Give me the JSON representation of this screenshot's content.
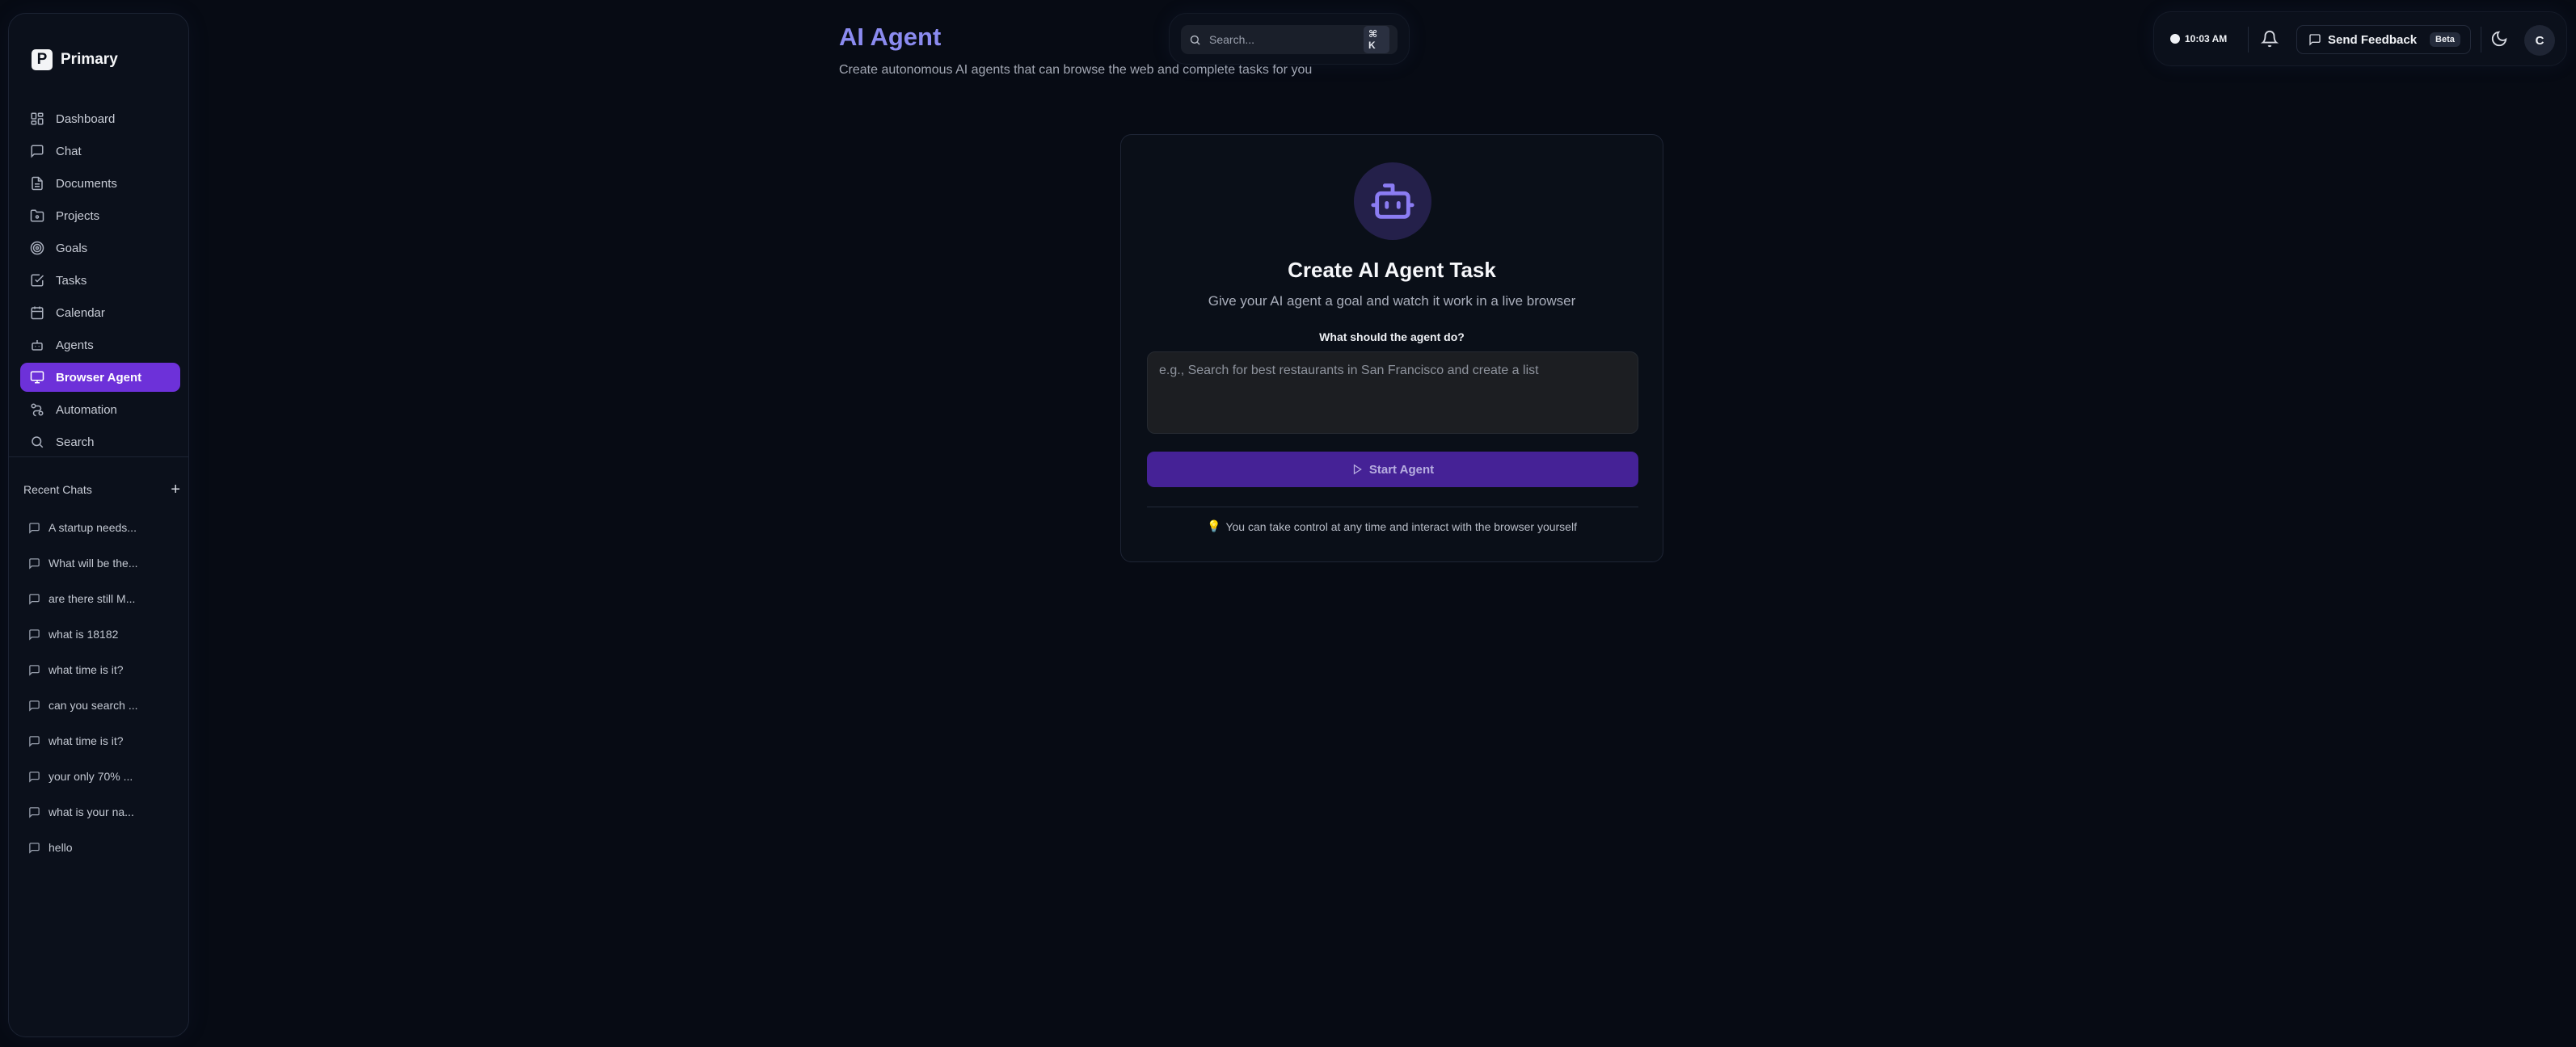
{
  "sidebar": {
    "brand": {
      "logo_letter": "P",
      "name": "Primary"
    },
    "nav": [
      {
        "label": "Dashboard",
        "icon": "dashboard-icon"
      },
      {
        "label": "Chat",
        "icon": "chat-icon"
      },
      {
        "label": "Documents",
        "icon": "document-icon"
      },
      {
        "label": "Projects",
        "icon": "folder-icon"
      },
      {
        "label": "Goals",
        "icon": "target-icon"
      },
      {
        "label": "Tasks",
        "icon": "checkbox-icon"
      },
      {
        "label": "Calendar",
        "icon": "calendar-icon"
      },
      {
        "label": "Agents",
        "icon": "bot-icon"
      },
      {
        "label": "Browser Agent",
        "icon": "monitor-icon",
        "active": true
      },
      {
        "label": "Automation",
        "icon": "workflow-icon"
      },
      {
        "label": "Search",
        "icon": "search-icon"
      }
    ],
    "recent_title": "Recent Chats",
    "recent_add": "+",
    "recent": [
      "A startup needs...",
      "What will be the...",
      "are there still M...",
      "what is 18182",
      "what time is it?",
      "can you search ...",
      "what time is it?",
      "your only 70% ...",
      "what is your na...",
      "hello"
    ]
  },
  "header": {
    "title": "AI Agent",
    "subtitle": "Create autonomous AI agents that can browse the web and complete tasks for you"
  },
  "search": {
    "placeholder": "Search...",
    "shortcut": "⌘ K"
  },
  "topbar": {
    "time": "10:03 AM",
    "feedback_label": "Send Feedback",
    "feedback_badge": "Beta",
    "avatar_letter": "C"
  },
  "card": {
    "title": "Create AI Agent Task",
    "description": "Give your AI agent a goal and watch it work in a live browser",
    "field_label": "What should the agent do?",
    "input_placeholder": "e.g., Search for best restaurants in San Francisco and create a list",
    "input_value": "",
    "start_label": "Start Agent",
    "tip_icon": "💡",
    "tip": "You can take control at any time and interact with the browser yourself"
  },
  "colors": {
    "accent": "#6d31d9",
    "accent_disabled": "#452296",
    "title_color": "#8b8bf0",
    "background": "#070b14"
  }
}
